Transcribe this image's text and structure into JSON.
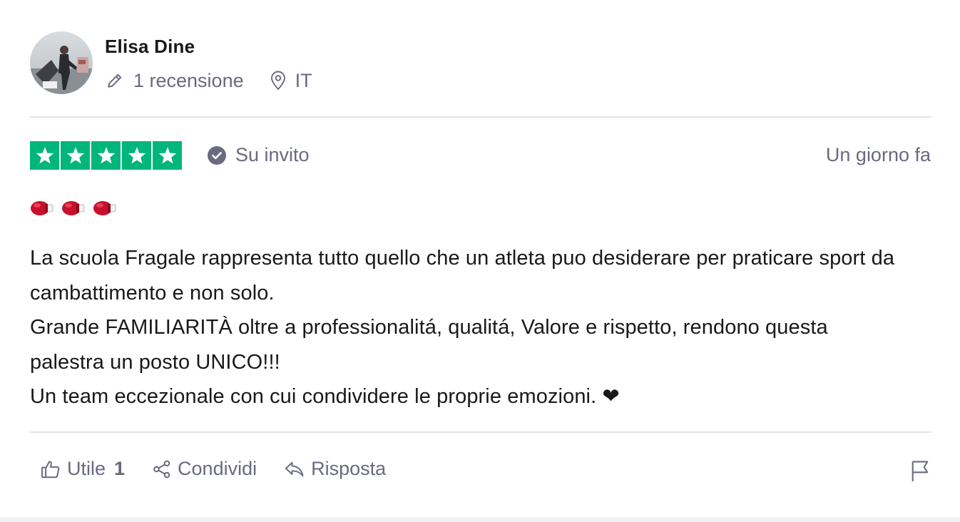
{
  "reviewer": {
    "name": "Elisa Dine",
    "review_count_label": "1 recensione",
    "country": "IT",
    "icons": {
      "reviews": "pencil-icon",
      "country": "location-pin-icon"
    }
  },
  "rating": {
    "stars": 5,
    "max_stars": 5,
    "color": "#00b67a",
    "invite_label": "Su invito",
    "date": "Un giorno fa"
  },
  "review": {
    "emojis": [
      "🥊",
      "🥊",
      "🥊"
    ],
    "lines": [
      "La scuola Fragale rappresenta tutto quello che un atleta puo desiderare per praticare sport da cambattimento e non solo.",
      "Grande FAMILIARITÀ oltre a professionalitá, qualitá, Valore e rispetto, rendono questa palestra un posto UNICO!!!",
      "Un team eccezionale con cui condividere le proprie emozioni. ❤"
    ]
  },
  "actions": {
    "useful_label": "Utile",
    "useful_count": "1",
    "share_label": "Condividi",
    "reply_label": "Risposta"
  },
  "colors": {
    "text": "#191919",
    "muted": "#696a80",
    "divider": "#e3e3ea",
    "star_green": "#00b67a"
  }
}
